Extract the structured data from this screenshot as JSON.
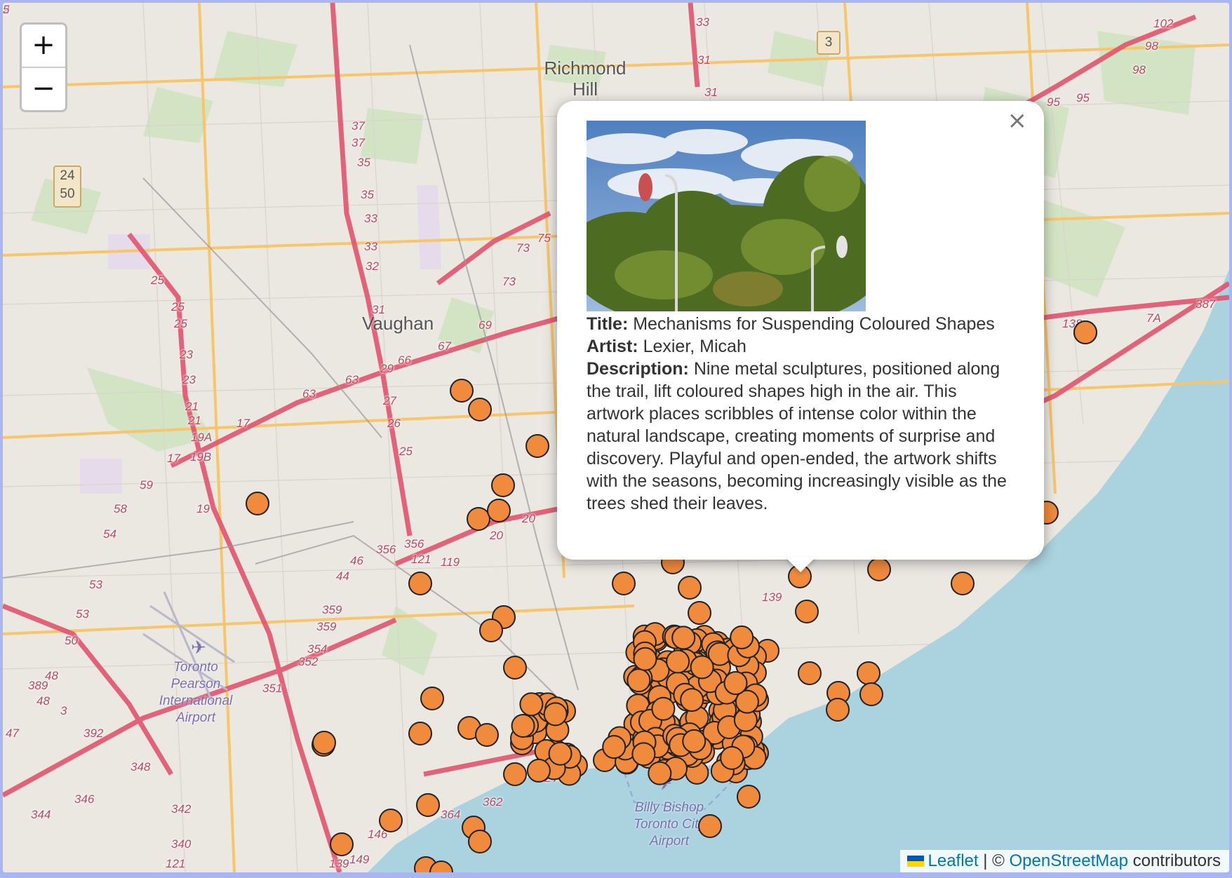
{
  "map": {
    "place_labels": [
      "Richmond Hill",
      "Vaughan",
      "Toronto Pearson International Airport",
      "Billy Bishop Toronto City Airport"
    ],
    "highway_shields": [
      "24",
      "50",
      "3"
    ],
    "road_numbers": [
      "102",
      "98",
      "98",
      "95",
      "95",
      "33",
      "31",
      "31",
      "37",
      "37",
      "35",
      "35",
      "33",
      "33",
      "32",
      "31",
      "73",
      "75",
      "73",
      "69",
      "67",
      "66",
      "63",
      "63",
      "29",
      "27",
      "26",
      "25",
      "25",
      "25",
      "25",
      "23",
      "23",
      "21",
      "21",
      "19A",
      "19B",
      "19",
      "17",
      "17",
      "59",
      "58",
      "54",
      "53",
      "53",
      "50",
      "48",
      "48",
      "47",
      "46",
      "44",
      "356",
      "356",
      "359",
      "359",
      "354",
      "352",
      "351",
      "348",
      "346",
      "344",
      "342",
      "340",
      "121",
      "121",
      "119",
      "20",
      "20",
      "364",
      "362",
      "2 A B",
      "146",
      "149",
      "139",
      "139",
      "138",
      "7A",
      "387",
      "389",
      "392",
      "3",
      "2",
      "5"
    ],
    "marker_color": "#f08a3c",
    "marker_count_note": ""
  },
  "zoom": {
    "in_label": "+",
    "out_label": "−"
  },
  "popup": {
    "close_label": "×",
    "title_label": "Title:",
    "title": "Mechanisms for Suspending Coloured Shapes",
    "artist_label": "Artist:",
    "artist": "Lexier, Micah",
    "description_label": "Description:",
    "description": "Nine metal sculptures, positioned along the trail, lift coloured shapes high in the air. This artwork places scribbles of intense color within the natural landscape, creating moments of surprise and discovery. Playful and open-ended, the artwork shifts with the seasons, becoming increasingly visible as the trees shed their leaves."
  },
  "attribution": {
    "leaflet": "Leaflet",
    "separator": "| ©",
    "osm": "OpenStreetMap",
    "suffix": "contributors"
  },
  "colors": {
    "water": "#aad3df",
    "land": "#ebe8e2",
    "green": "#c7e0b4",
    "highway": "#e0546e",
    "major_road": "#f7c56b",
    "marker": "#f08a3c",
    "link": "#0078a8"
  }
}
